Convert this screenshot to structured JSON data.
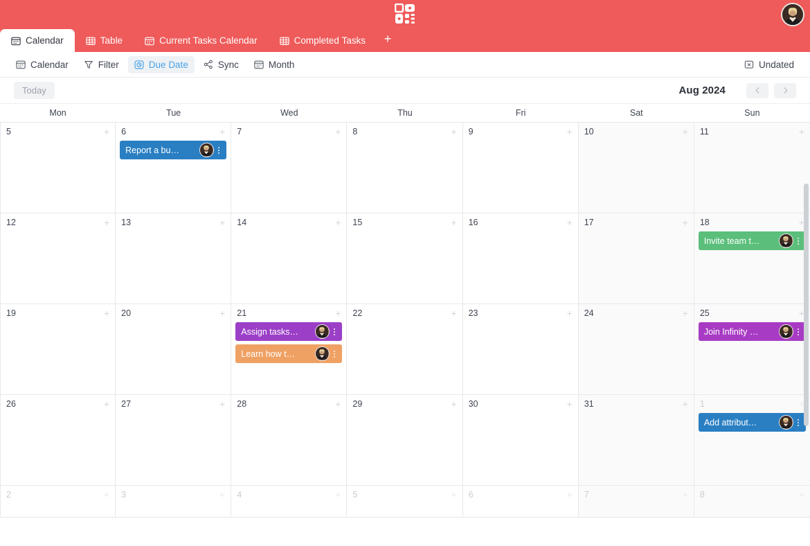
{
  "app": {
    "logo_icon": "infinity-qr-logo",
    "avatar_icon": "user-avatar",
    "brand_color": "#ef5a5a"
  },
  "tabs": {
    "items": [
      {
        "label": "Calendar",
        "icon": "calendar-icon",
        "active": true
      },
      {
        "label": "Table",
        "icon": "table-icon",
        "active": false
      },
      {
        "label": "Current Tasks Calendar",
        "icon": "calendar-icon",
        "active": false
      },
      {
        "label": "Completed Tasks",
        "icon": "table-icon",
        "active": false
      }
    ],
    "add_label": "+"
  },
  "toolbar": {
    "items": [
      {
        "label": "Calendar",
        "icon": "calendar-icon",
        "active": false
      },
      {
        "label": "Filter",
        "icon": "filter-icon",
        "active": false
      },
      {
        "label": "Due Date",
        "icon": "due-date-icon",
        "active": true
      },
      {
        "label": "Sync",
        "icon": "sync-icon",
        "active": false
      },
      {
        "label": "Month",
        "icon": "calendar-icon",
        "active": false
      }
    ],
    "undated_label": "Undated",
    "undated_icon": "boxed-x-icon",
    "active_color": "#4aa3e8"
  },
  "datenav": {
    "today_label": "Today",
    "month_label": "Aug 2024",
    "prev_icon": "chevron-left-icon",
    "next_icon": "chevron-right-icon"
  },
  "calendar": {
    "weekdays": [
      "Mon",
      "Tue",
      "Wed",
      "Thu",
      "Fri",
      "Sat",
      "Sun"
    ],
    "weeks": [
      {
        "days": [
          {
            "num": "5",
            "muted": false,
            "weekend": false,
            "events": []
          },
          {
            "num": "6",
            "muted": false,
            "weekend": false,
            "events": [
              {
                "title": "Report a bu…",
                "color": "#2a7fc3",
                "avatar": "user-avatar",
                "menu": "kebab-icon"
              }
            ]
          },
          {
            "num": "7",
            "muted": false,
            "weekend": false,
            "events": []
          },
          {
            "num": "8",
            "muted": false,
            "weekend": false,
            "events": []
          },
          {
            "num": "9",
            "muted": false,
            "weekend": false,
            "events": []
          },
          {
            "num": "10",
            "muted": false,
            "weekend": true,
            "events": []
          },
          {
            "num": "11",
            "muted": false,
            "weekend": true,
            "events": []
          }
        ]
      },
      {
        "days": [
          {
            "num": "12",
            "muted": false,
            "weekend": false,
            "events": []
          },
          {
            "num": "13",
            "muted": false,
            "weekend": false,
            "events": []
          },
          {
            "num": "14",
            "muted": false,
            "weekend": false,
            "events": []
          },
          {
            "num": "15",
            "muted": false,
            "weekend": false,
            "events": []
          },
          {
            "num": "16",
            "muted": false,
            "weekend": false,
            "events": []
          },
          {
            "num": "17",
            "muted": false,
            "weekend": true,
            "events": []
          },
          {
            "num": "18",
            "muted": false,
            "weekend": true,
            "events": [
              {
                "title": "Invite team t…",
                "color": "#5bbf7b",
                "avatar": "user-avatar",
                "menu": "kebab-icon"
              }
            ]
          }
        ]
      },
      {
        "days": [
          {
            "num": "19",
            "muted": false,
            "weekend": false,
            "events": []
          },
          {
            "num": "20",
            "muted": false,
            "weekend": false,
            "events": []
          },
          {
            "num": "21",
            "muted": false,
            "weekend": false,
            "events": [
              {
                "title": "Assign tasks…",
                "color": "#9b3fc7",
                "avatar": "user-avatar",
                "menu": "kebab-icon"
              },
              {
                "title": "Learn how t…",
                "color": "#efa164",
                "avatar": "user-avatar",
                "menu": "kebab-icon"
              }
            ]
          },
          {
            "num": "22",
            "muted": false,
            "weekend": false,
            "events": []
          },
          {
            "num": "23",
            "muted": false,
            "weekend": false,
            "events": []
          },
          {
            "num": "24",
            "muted": false,
            "weekend": true,
            "events": []
          },
          {
            "num": "25",
            "muted": false,
            "weekend": true,
            "events": [
              {
                "title": "Join Infinity …",
                "color": "#a83bc4",
                "avatar": "user-avatar",
                "menu": "kebab-icon"
              }
            ]
          }
        ]
      },
      {
        "days": [
          {
            "num": "26",
            "muted": false,
            "weekend": false,
            "events": []
          },
          {
            "num": "27",
            "muted": false,
            "weekend": false,
            "events": []
          },
          {
            "num": "28",
            "muted": false,
            "weekend": false,
            "events": []
          },
          {
            "num": "29",
            "muted": false,
            "weekend": false,
            "events": []
          },
          {
            "num": "30",
            "muted": false,
            "weekend": false,
            "events": []
          },
          {
            "num": "31",
            "muted": false,
            "weekend": true,
            "events": []
          },
          {
            "num": "1",
            "muted": true,
            "weekend": true,
            "events": [
              {
                "title": "Add attribut…",
                "color": "#2a7fc3",
                "avatar": "user-avatar",
                "menu": "kebab-icon"
              }
            ]
          }
        ]
      },
      {
        "partial": true,
        "days": [
          {
            "num": "2",
            "muted": true,
            "weekend": false,
            "events": []
          },
          {
            "num": "3",
            "muted": true,
            "weekend": false,
            "events": []
          },
          {
            "num": "4",
            "muted": true,
            "weekend": false,
            "events": []
          },
          {
            "num": "5",
            "muted": true,
            "weekend": false,
            "events": []
          },
          {
            "num": "6",
            "muted": true,
            "weekend": false,
            "events": []
          },
          {
            "num": "7",
            "muted": true,
            "weekend": true,
            "events": []
          },
          {
            "num": "8",
            "muted": true,
            "weekend": true,
            "events": []
          }
        ]
      }
    ],
    "add_event_icon": "plus-icon"
  }
}
